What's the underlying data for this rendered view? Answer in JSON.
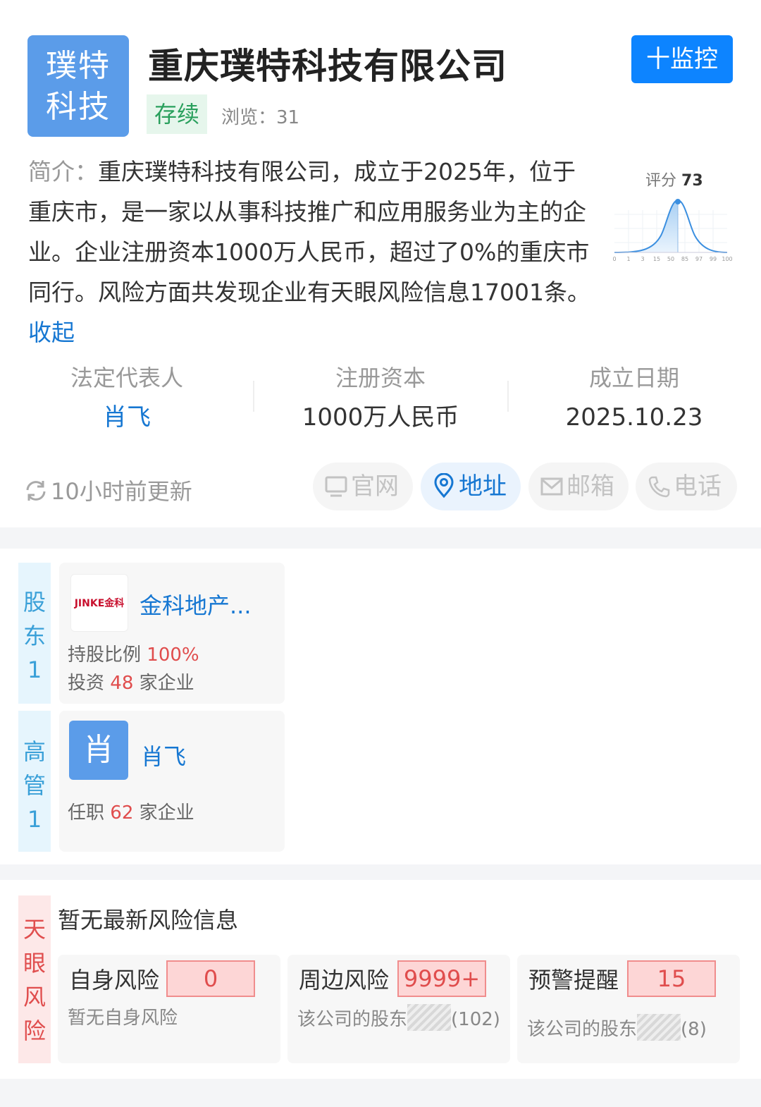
{
  "header": {
    "logo_line1": "璞特",
    "logo_line2": "科技",
    "company_name": "重庆璞特科技有限公司",
    "monitor_label": "十监控",
    "status": "存续",
    "views_label": "浏览：",
    "views_count": "31"
  },
  "intro": {
    "label": "简介：",
    "text": "重庆璞特科技有限公司，成立于2025年，位于重庆市，是一家以从事科技推广和应用服务业为主的企业。企业注册资本1000万人民币，超过了0%的重庆市同行。风险方面共发现企业有天眼风险信息17001条。",
    "collapse": "收起"
  },
  "score": {
    "label": "评分",
    "value": "73",
    "ticks": [
      "0",
      "1",
      "3",
      "15",
      "50",
      "85",
      "97",
      "99",
      "100"
    ]
  },
  "facts": [
    {
      "label": "法定代表人",
      "value": "肖飞"
    },
    {
      "label": "注册资本",
      "value": "1000万人民币"
    },
    {
      "label": "成立日期",
      "value": "2025.10.23"
    }
  ],
  "update_text": "10小时前更新",
  "contacts": [
    {
      "label": "官网",
      "icon": "monitor-icon"
    },
    {
      "label": "地址",
      "icon": "location-pin-icon"
    },
    {
      "label": "邮箱",
      "icon": "mail-icon"
    },
    {
      "label": "电话",
      "icon": "phone-icon"
    }
  ],
  "shareholders": {
    "tab": [
      "股",
      "东",
      "1"
    ],
    "logo_text": "JINKE金科",
    "name": "金科地产...",
    "ratio_label": "持股比例",
    "ratio_value": "100%",
    "invest_pre": "投资",
    "invest_count": "48",
    "invest_post": "家企业"
  },
  "executives": {
    "tab": [
      "高",
      "管",
      "1"
    ],
    "avatar": "肖",
    "name": "肖飞",
    "role_pre": "任职",
    "role_count": "62",
    "role_post": "家企业"
  },
  "risk": {
    "tab": [
      "天",
      "眼",
      "风",
      "险"
    ],
    "no_new": "暂无最新风险信息",
    "items": [
      {
        "title": "自身风险",
        "count": "0",
        "sub": "暂无自身风险"
      },
      {
        "title": "周边风险",
        "count": "9999+",
        "sub_pre": "该公司的股东",
        "sub_post": "(102)"
      },
      {
        "title": "预警提醒",
        "count": "15",
        "sub_pre": "该公司的股东",
        "sub_post": "(8)"
      }
    ]
  },
  "colors": {
    "accent": "#0d84ff",
    "link": "#1677d2",
    "risk": "#e04d4d",
    "status": "#2aa05d"
  }
}
